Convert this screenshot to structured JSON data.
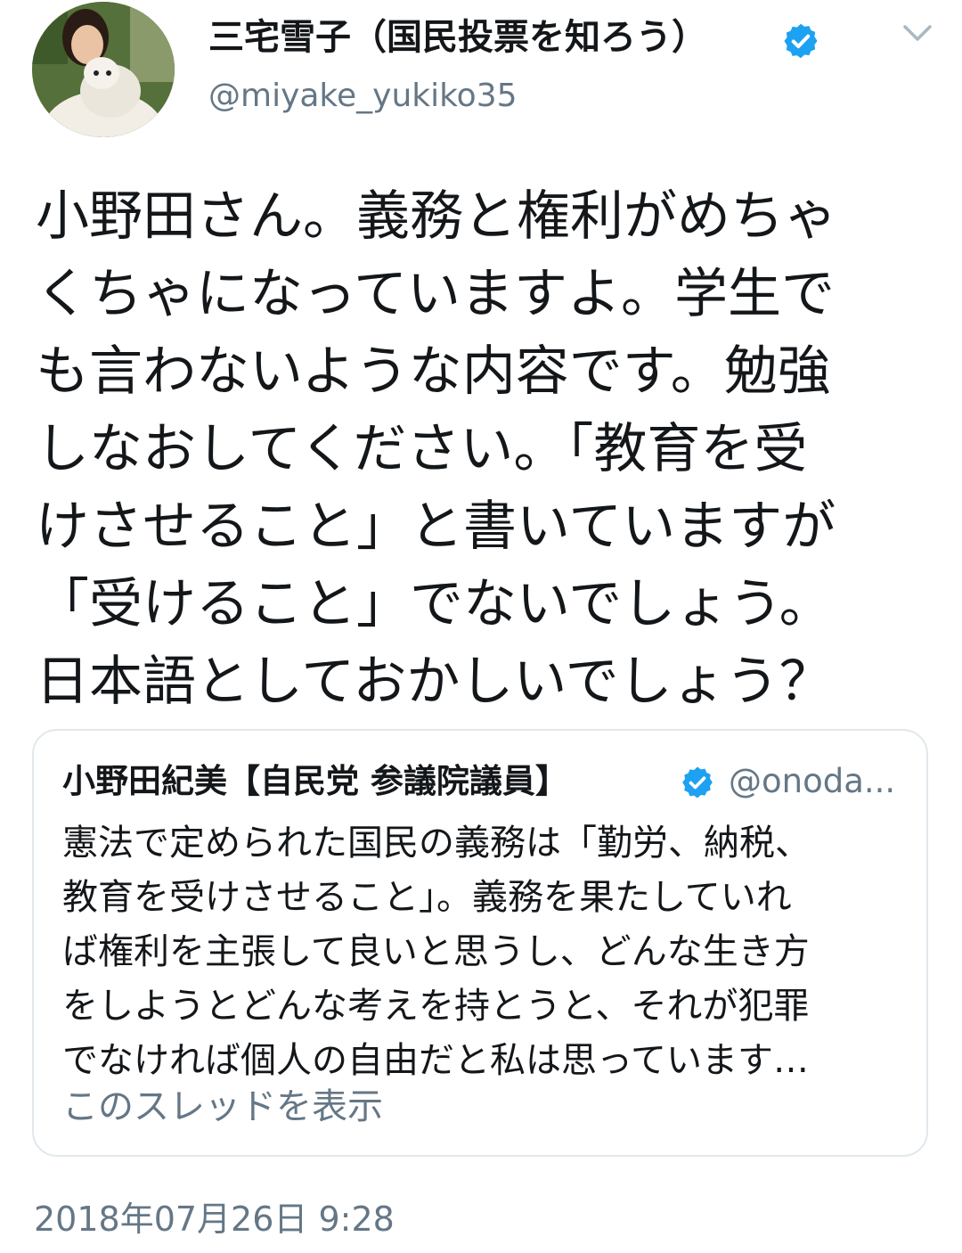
{
  "author": {
    "name": "三宅雪子（国民投票を知ろう）",
    "handle": "@miyake_yukiko35",
    "verified": true,
    "avatar_icon": "profile-photo-with-dog"
  },
  "tweet": {
    "lines": [
      "小野田さん。義務と権利がめちゃ",
      "くちゃになっていますよ。学生で",
      "も言わないような内容です。勉強",
      "しなおしてください。「教育を受",
      "けさせること」と書いていますが",
      "「受けること」でないでしょう。",
      "日本語としておかしいでしょう？"
    ]
  },
  "quoted_tweet": {
    "name": "小野田紀美【自民党 参議院議員】",
    "handle": "@onoda...",
    "verified": true,
    "lines": [
      "憲法で定められた国民の義務は「勤労、納税、",
      "教育を受けさせること」。義務を果たしていれ",
      "ば権利を主張して良いと思うし、どんな生き方",
      "をしようとどんな考えを持とうと、それが犯罪",
      "でなければ個人の自由だと私は思っています…"
    ],
    "show_thread": "このスレッドを表示"
  },
  "timestamp": "2018年07月26日 9:28",
  "colors": {
    "verified_badge": "#1da1f2",
    "secondary_text": "#657786",
    "border": "#e1e8ed"
  },
  "icons": {
    "menu": "chevron-down-icon",
    "verified": "verified-badge-icon"
  }
}
